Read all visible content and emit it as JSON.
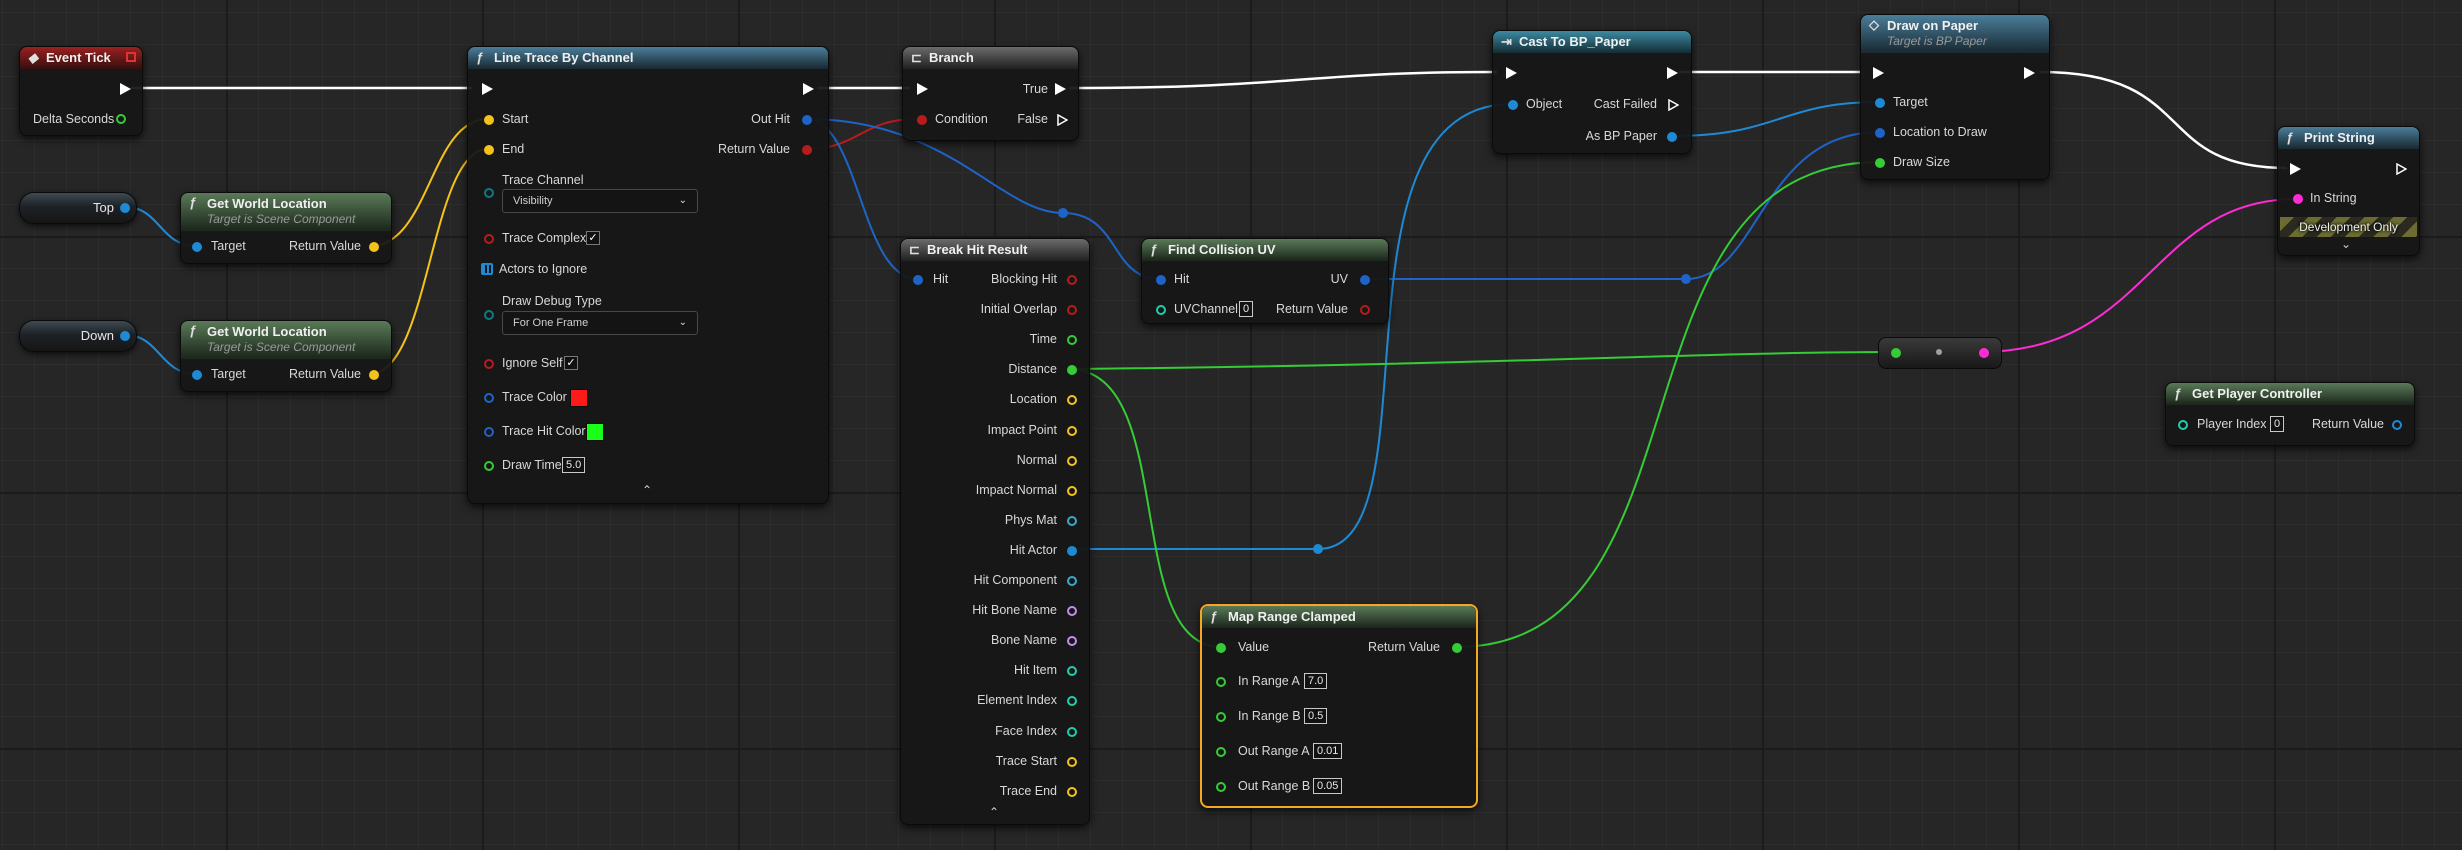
{
  "colors": {
    "exec": "#ffffff",
    "object": "#1e8ad6",
    "vector": "#f5c21b",
    "bool": "#b71c1c",
    "float": "#35cc35",
    "string": "#ff2cd6",
    "struct": "#1e64c8",
    "linearcolor": "#f0b400",
    "material": "#3aa8c8",
    "name": "#c68cf0",
    "int": "#20cfa8",
    "class": "#5a2ca0",
    "channel_enum": "#0e7a80"
  },
  "nodes": {
    "event_tick": {
      "title": "Event Tick",
      "delta_seconds": "Delta Seconds"
    },
    "var_top": {
      "label": "Top"
    },
    "var_down": {
      "label": "Down"
    },
    "gwl1": {
      "title": "Get World Location",
      "subtitle": "Target is Scene Component",
      "target": "Target",
      "return_value": "Return Value"
    },
    "gwl2": {
      "title": "Get World Location",
      "subtitle": "Target is Scene Component",
      "target": "Target",
      "return_value": "Return Value"
    },
    "line_trace": {
      "title": "Line Trace By Channel",
      "start": "Start",
      "end": "End",
      "out_hit": "Out Hit",
      "return_value": "Return Value",
      "trace_channel": "Trace Channel",
      "trace_channel_value": "Visibility",
      "trace_complex": "Trace Complex",
      "trace_complex_checked": "✓",
      "actors_to_ignore": "Actors to Ignore",
      "draw_debug_type": "Draw Debug Type",
      "draw_debug_type_value": "For One Frame",
      "ignore_self": "Ignore Self",
      "ignore_self_checked": "✓",
      "trace_color": "Trace Color",
      "trace_color_value": "#ff1a1a",
      "trace_hit_color": "Trace Hit Color",
      "trace_hit_color_value": "#1aff1a",
      "draw_time": "Draw Time",
      "draw_time_value": "5.0"
    },
    "branch": {
      "title": "Branch",
      "condition": "Condition",
      "true": "True",
      "false": "False"
    },
    "break_hit": {
      "title": "Break Hit Result",
      "hit": "Hit",
      "outputs": [
        "Blocking Hit",
        "Initial Overlap",
        "Time",
        "Distance",
        "Location",
        "Impact Point",
        "Normal",
        "Impact Normal",
        "Phys Mat",
        "Hit Actor",
        "Hit Component",
        "Hit Bone Name",
        "Bone Name",
        "Hit Item",
        "Element Index",
        "Face Index",
        "Trace Start",
        "Trace End"
      ]
    },
    "find_uv": {
      "title": "Find Collision UV",
      "hit": "Hit",
      "uv_channel": "UVChannel",
      "uv_channel_value": "0",
      "uv": "UV",
      "return_value": "Return Value"
    },
    "map_range": {
      "title": "Map Range Clamped",
      "value": "Value",
      "return_value": "Return Value",
      "in_range_a": "In Range A",
      "in_range_a_value": "7.0",
      "in_range_b": "In Range B",
      "in_range_b_value": "0.5",
      "out_range_a": "Out Range A",
      "out_range_a_value": "0.01",
      "out_range_b": "Out Range B",
      "out_range_b_value": "0.05"
    },
    "cast": {
      "title": "Cast To BP_Paper",
      "object": "Object",
      "cast_failed": "Cast Failed",
      "as_bp_paper": "As BP Paper"
    },
    "draw_on_paper": {
      "title": "Draw on Paper",
      "subtitle": "Target is BP Paper",
      "target": "Target",
      "location_to_draw": "Location to Draw",
      "draw_size": "Draw Size"
    },
    "print_string": {
      "title": "Print String",
      "in_string": "In String",
      "dev_only": "Development Only"
    },
    "get_pc": {
      "title": "Get Player Controller",
      "player_index": "Player Index",
      "player_index_value": "0",
      "return_value": "Return Value"
    }
  }
}
